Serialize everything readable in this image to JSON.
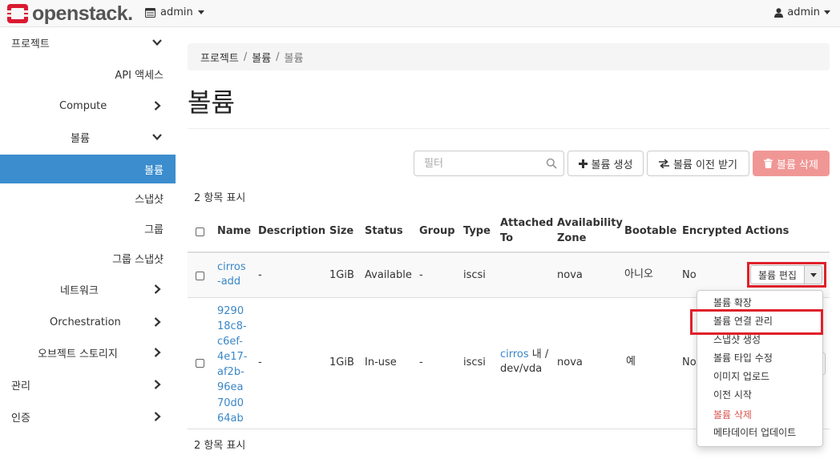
{
  "navbar": {
    "brand": "openstack.",
    "project": "admin",
    "user": "admin"
  },
  "sidebar": {
    "items": [
      {
        "label": "프로젝트",
        "chevron": "down"
      },
      {
        "label": "API 액세스"
      },
      {
        "label": "Compute",
        "chevron": "right"
      },
      {
        "label": "볼륨",
        "chevron": "down"
      },
      {
        "label": "볼륨",
        "active": true
      },
      {
        "label": "스냅샷"
      },
      {
        "label": "그룹"
      },
      {
        "label": "그룹 스냅샷"
      },
      {
        "label": "네트워크",
        "chevron": "right"
      },
      {
        "label": "Orchestration",
        "chevron": "right"
      },
      {
        "label": "오브젝트 스토리지",
        "chevron": "right"
      },
      {
        "label": "관리",
        "chevron": "right"
      },
      {
        "label": "인증",
        "chevron": "right"
      }
    ]
  },
  "breadcrumb": [
    "프로젝트",
    "볼륨",
    "볼륨"
  ],
  "page_title": "볼륨",
  "toolbar": {
    "filter_placeholder": "필터",
    "create_label": "볼륨 생성",
    "transfer_label": "볼륨 이전 받기",
    "delete_label": "볼륨 삭제"
  },
  "count_top": "2 항목 표시",
  "count_bottom": "2 항목 표시",
  "table": {
    "headers": {
      "name": "Name",
      "description": "Description",
      "size": "Size",
      "status": "Status",
      "group": "Group",
      "type": "Type",
      "attached_1": "Attached",
      "attached_2": "To",
      "az_1": "Availability",
      "az_2": "Zone",
      "bootable": "Bootable",
      "encrypted": "Encrypted",
      "actions": "Actions"
    },
    "rows": [
      {
        "name_lines": [
          "cirros",
          "-add"
        ],
        "description": "-",
        "size": "1GiB",
        "status": "Available",
        "group": "-",
        "type": "iscsi",
        "attached_link": "",
        "attached_rest": "",
        "az": "nova",
        "bootable": "아니오",
        "encrypted": "No",
        "action_label": "볼륨 편집"
      },
      {
        "name_lines": [
          "9290",
          "18c8-",
          "c6ef-",
          "4e17-",
          "af2b-",
          "96ea",
          "70d0",
          "64ab"
        ],
        "description": "-",
        "size": "1GiB",
        "status": "In-use",
        "group": "-",
        "type": "iscsi",
        "attached_link": "cirros",
        "attached_rest_1": " 내 /",
        "attached_rest_2": "dev/vda",
        "az": "nova",
        "bootable": "예",
        "encrypted": "No"
      }
    ]
  },
  "dropdown_menu": [
    {
      "label": "볼륨 확장"
    },
    {
      "label": "볼륨 연결 관리"
    },
    {
      "label": "스냅샷 생성"
    },
    {
      "label": "볼륨 타입 수정"
    },
    {
      "label": "이미지 업로드"
    },
    {
      "label": "이전 시작"
    },
    {
      "label": "볼륨 삭제",
      "danger": true
    },
    {
      "label": "메타데이터 업데이트"
    }
  ],
  "colors": {
    "active_nav": "#3c8dce",
    "link": "#3a87c8",
    "danger_button": "#f09795",
    "highlight_box": "#e0202a",
    "brand_logo": "#da1a32"
  }
}
